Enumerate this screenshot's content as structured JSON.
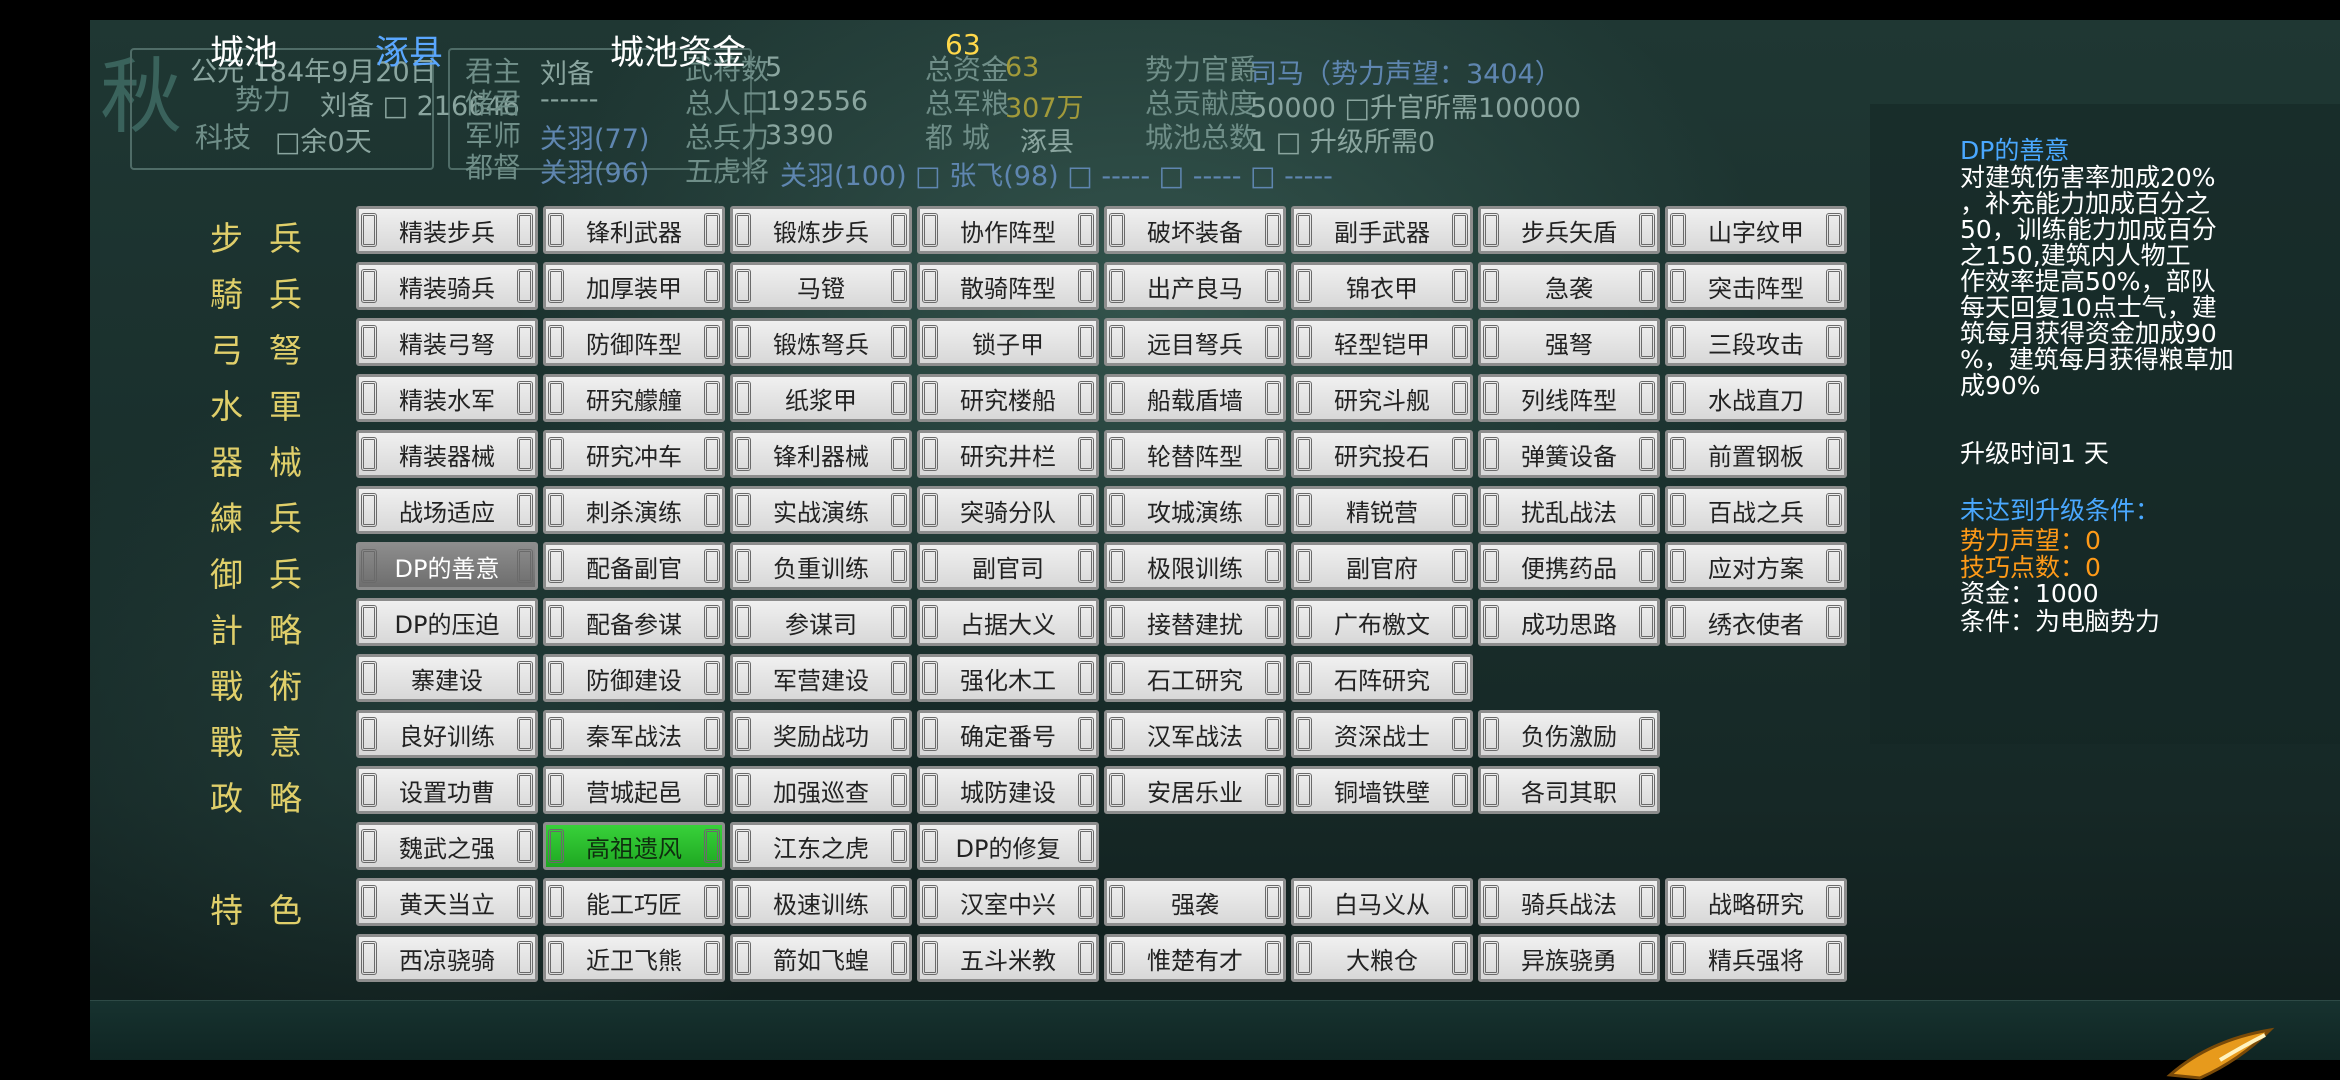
{
  "header": {
    "city_label": "城池",
    "city_name": "涿县",
    "funds_label": "城池资金",
    "funds_value": "63"
  },
  "info": {
    "season": "秋",
    "date": "公元 184年9月20日",
    "force_label": "势力",
    "force_value": "刘备 □ 216646",
    "tech_label": "科技",
    "tech_value": "□余0天",
    "monarch_label": "君主",
    "monarch_value": "刘备",
    "heir_label": "储君",
    "heir_value": "------",
    "strategist_label": "军师",
    "strategist_value": "关羽(77)",
    "governor_label": "都督",
    "governor_value": "关羽(96)",
    "generals_label": "武将数",
    "generals_value": "5",
    "population_label": "总人口",
    "population_value": "192556",
    "troops_label": "总兵力",
    "troops_value": "3390",
    "five_tigers_label": "五虎将",
    "five_tigers_value": "关羽(100) □ 张飞(98) □ ----- □ ----- □ -----",
    "total_funds_label": "总资金",
    "total_funds_value": "63",
    "total_food_label": "总军粮",
    "total_food_value": "307万",
    "capital_label": "都 城",
    "capital_value": "涿县",
    "rank_label": "势力官爵",
    "rank_value": "司马（势力声望：3404）",
    "contribution_label": "总贡献度",
    "contribution_value": "50000 □升官所需100000",
    "cities_label": "城池总数",
    "cities_value": "1 □ 升级所需0"
  },
  "categories": [
    "步兵",
    "騎兵",
    "弓弩",
    "水軍",
    "器械",
    "練兵",
    "御兵",
    "計略",
    "戰術",
    "戰意",
    "政略",
    "特色"
  ],
  "techs": [
    [
      "精装步兵",
      "锋利武器",
      "锻炼步兵",
      "协作阵型",
      "破坏装备",
      "副手武器",
      "步兵矢盾",
      "山字纹甲"
    ],
    [
      "精装骑兵",
      "加厚装甲",
      "马镫",
      "散骑阵型",
      "出产良马",
      "锦衣甲",
      "急袭",
      "突击阵型"
    ],
    [
      "精装弓弩",
      "防御阵型",
      "锻炼弩兵",
      "锁子甲",
      "远目弩兵",
      "轻型铠甲",
      "强弩",
      "三段攻击"
    ],
    [
      "精装水军",
      "研究艨艟",
      "纸浆甲",
      "研究楼船",
      "船载盾墙",
      "研究斗舰",
      "列线阵型",
      "水战直刀"
    ],
    [
      "精装器械",
      "研究冲车",
      "锋利器械",
      "研究井栏",
      "轮替阵型",
      "研究投石",
      "弹簧设备",
      "前置钢板"
    ],
    [
      "战场适应",
      "刺杀演练",
      "实战演练",
      "突骑分队",
      "攻城演练",
      "精锐营",
      "扰乱战法",
      "百战之兵"
    ],
    [
      "DP的善意",
      "配备副官",
      "负重训练",
      "副官司",
      "极限训练",
      "副官府",
      "便携药品",
      "应对方案"
    ],
    [
      "DP的压迫",
      "配备参谋",
      "参谋司",
      "占据大义",
      "接替建扰",
      "广布檄文",
      "成功思路",
      "绣衣使者"
    ],
    [
      "寨建设",
      "防御建设",
      "军营建设",
      "强化木工",
      "石工研究",
      "石阵研究"
    ],
    [
      "良好训练",
      "秦军战法",
      "奖励战功",
      "确定番号",
      "汉军战法",
      "资深战士",
      "负伤激励"
    ],
    [
      "设置功曹",
      "营城起邑",
      "加强巡查",
      "城防建设",
      "安居乐业",
      "铜墙铁壁",
      "各司其职"
    ],
    [
      "魏武之强",
      "高祖遗风",
      "江东之虎",
      "DP的修复"
    ],
    [
      "黄天当立",
      "能工巧匠",
      "极速训练",
      "汉室中兴",
      "强袭",
      "白马义从",
      "骑兵战法",
      "战略研究"
    ],
    [
      "西凉骁骑",
      "近卫飞熊",
      "箭如飞蝗",
      "五斗米教",
      "惟楚有才",
      "大粮仓",
      "异族骁勇",
      "精兵强将"
    ]
  ],
  "selected": {
    "dark": "DP的善意",
    "green": "高祖遗风"
  },
  "details": {
    "title": "DP的善意",
    "description_lines": [
      "对建筑伤害率加成20%",
      "，补充能力加成百分之",
      "50，训练能力加成百分",
      "之150,建筑内人物工",
      "作效率提高50%，部队",
      "每天回复10点士气，建",
      "筑每月获得资金加成90",
      "%，建筑每月获得粮草加",
      "成90%"
    ],
    "upgrade_time": "升级时间1 天",
    "unmet_title": "未达到升级条件：",
    "req_prestige": "势力声望：0",
    "req_skill": "技巧点数：0",
    "req_funds": "资金：1000",
    "req_condition": "条件：为电脑势力"
  },
  "colors": {
    "category": "#e0cf6a",
    "city_name": "#5aa7ff",
    "funds": "#ffd84a",
    "detail_title": "#4aa8ff",
    "requirement": "#ff9a18",
    "selected_green": "#2cc22f"
  }
}
